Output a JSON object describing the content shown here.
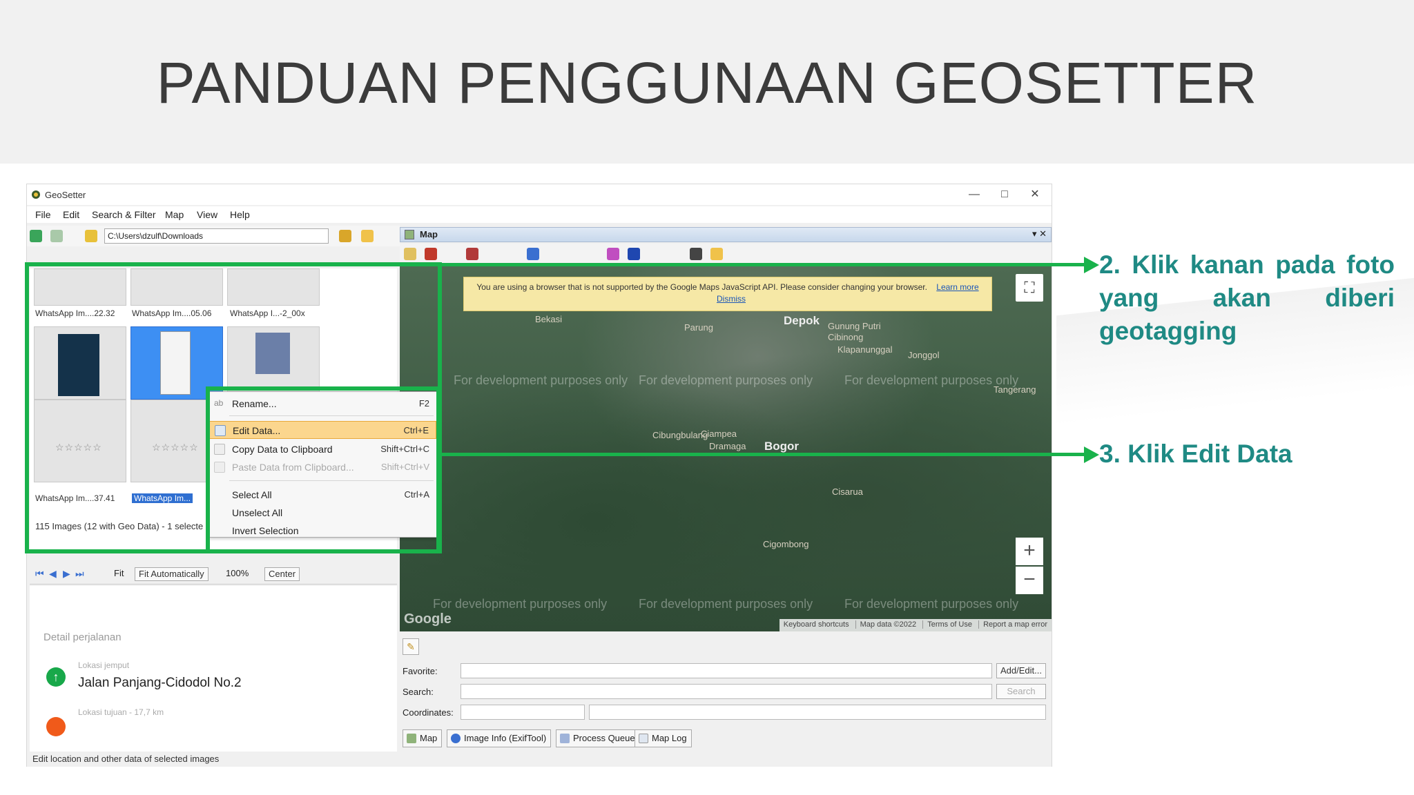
{
  "slide": {
    "title": "PANDUAN PENGGUNAAN GEOSETTER"
  },
  "window": {
    "title": "GeoSetter",
    "controls": [
      "—",
      "□",
      "✕"
    ]
  },
  "menu": [
    "File",
    "Edit",
    "Search & Filter",
    "Map",
    "View",
    "Help"
  ],
  "toolbar": {
    "path": "C:\\Users\\dzulf\\Downloads"
  },
  "thumbnails": {
    "labels": [
      "WhatsApp Im....22.32",
      "WhatsApp Im....05.06",
      "WhatsApp I...-2_00x",
      "WhatsApp Im....37.41",
      "WhatsApp Im..."
    ],
    "stars": "☆☆☆☆☆",
    "status": "115 Images (12 with Geo Data) - 1 selecte"
  },
  "viewer": {
    "fit_label": "Fit",
    "fit_auto": "Fit Automatically",
    "zoom": "100%",
    "center": "Center"
  },
  "preview": {
    "detail_title": "Detail perjalanan",
    "loc_label": "Lokasi jemput",
    "loc_name": "Jalan Panjang-Cidodol No.2",
    "loc_label2": "Lokasi tujuan - 17,7 km"
  },
  "status_bar": "Edit location and other data of selected images",
  "map": {
    "header": "Map",
    "header_ctrl": "▾ ✕",
    "warning": "You are using a browser that is not supported by the Google Maps JavaScript API. Please consider changing your browser.",
    "learn_more": "Learn more",
    "dismiss": "Dismiss",
    "dev_text": "For development purposes only",
    "labels": [
      "Depok",
      "Bogor",
      "Cibinong",
      "Gunung Putri",
      "Klapanunggal",
      "Jonggol",
      "Ciampea",
      "Dramaga",
      "Cigombong",
      "Cisarua",
      "Tangerang",
      "Parung",
      "Bekasi",
      "Cibungbulang"
    ],
    "google": "Google",
    "attribution": [
      "Keyboard shortcuts",
      "Map data ©2022",
      "Terms of Use",
      "Report a map error"
    ],
    "zoom_in": "+",
    "zoom_out": "−",
    "fullscreen": "⛶"
  },
  "form": {
    "favorite_label": "Favorite:",
    "search_label": "Search:",
    "coordinates_label": "Coordinates:",
    "add_edit": "Add/Edit...",
    "search_btn": "Search"
  },
  "tabs": [
    "Map",
    "Image Info (ExifTool)",
    "Process Queue",
    "Map Log"
  ],
  "context_menu": [
    {
      "label": "Rename...",
      "shortcut": "F2",
      "state": "normal"
    },
    {
      "label": "Edit Data...",
      "shortcut": "Ctrl+E",
      "state": "highlighted"
    },
    {
      "label": "Copy Data to Clipboard",
      "shortcut": "Shift+Ctrl+C",
      "state": "normal"
    },
    {
      "label": "Paste Data from Clipboard...",
      "shortcut": "Shift+Ctrl+V",
      "state": "disabled"
    },
    {
      "label": "Select All",
      "shortcut": "Ctrl+A",
      "state": "normal"
    },
    {
      "label": "Unselect All",
      "shortcut": "",
      "state": "normal"
    },
    {
      "label": "Invert Selection",
      "shortcut": "",
      "state": "normal"
    }
  ],
  "annotations": {
    "note2": "2. Klik kanan pada foto yang akan diberi geotagging",
    "note3": "3. Klik Edit Data",
    "highlight_color": "#19b24b",
    "note_color": "#1f8a84"
  }
}
